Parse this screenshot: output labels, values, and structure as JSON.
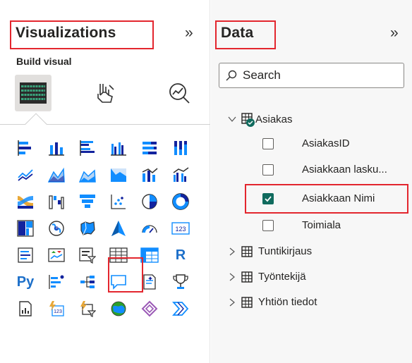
{
  "visualizations": {
    "title": "Visualizations",
    "build_visual_label": "Build visual",
    "expand_icon": "double-chevron-right-icon",
    "build_tabs": [
      "build-visual-icon",
      "format-visual-icon",
      "analytics-icon"
    ],
    "r_label": "R",
    "py_label": "Py",
    "gauge_card_label": "123"
  },
  "data": {
    "title": "Data",
    "expand_icon": "double-chevron-right-icon",
    "search": {
      "placeholder": "Search"
    },
    "tables": [
      {
        "name": "Asiakas",
        "expanded": true,
        "fields": [
          {
            "name": "AsiakasID",
            "checked": false
          },
          {
            "name": "Asiakkaan lasku...",
            "checked": false
          },
          {
            "name": "Asiakkaan Nimi",
            "checked": true
          },
          {
            "name": "Toimiala",
            "checked": false
          }
        ]
      },
      {
        "name": "Tuntikirjaus",
        "expanded": false
      },
      {
        "name": "Työntekijä",
        "expanded": false
      },
      {
        "name": "Yhtiön tiedot",
        "expanded": false
      }
    ]
  },
  "colors": {
    "highlight_red": "#e3262e",
    "check_green": "#106b5e",
    "brand_blue": "#118dff",
    "r_blue": "#1c6fc9"
  }
}
